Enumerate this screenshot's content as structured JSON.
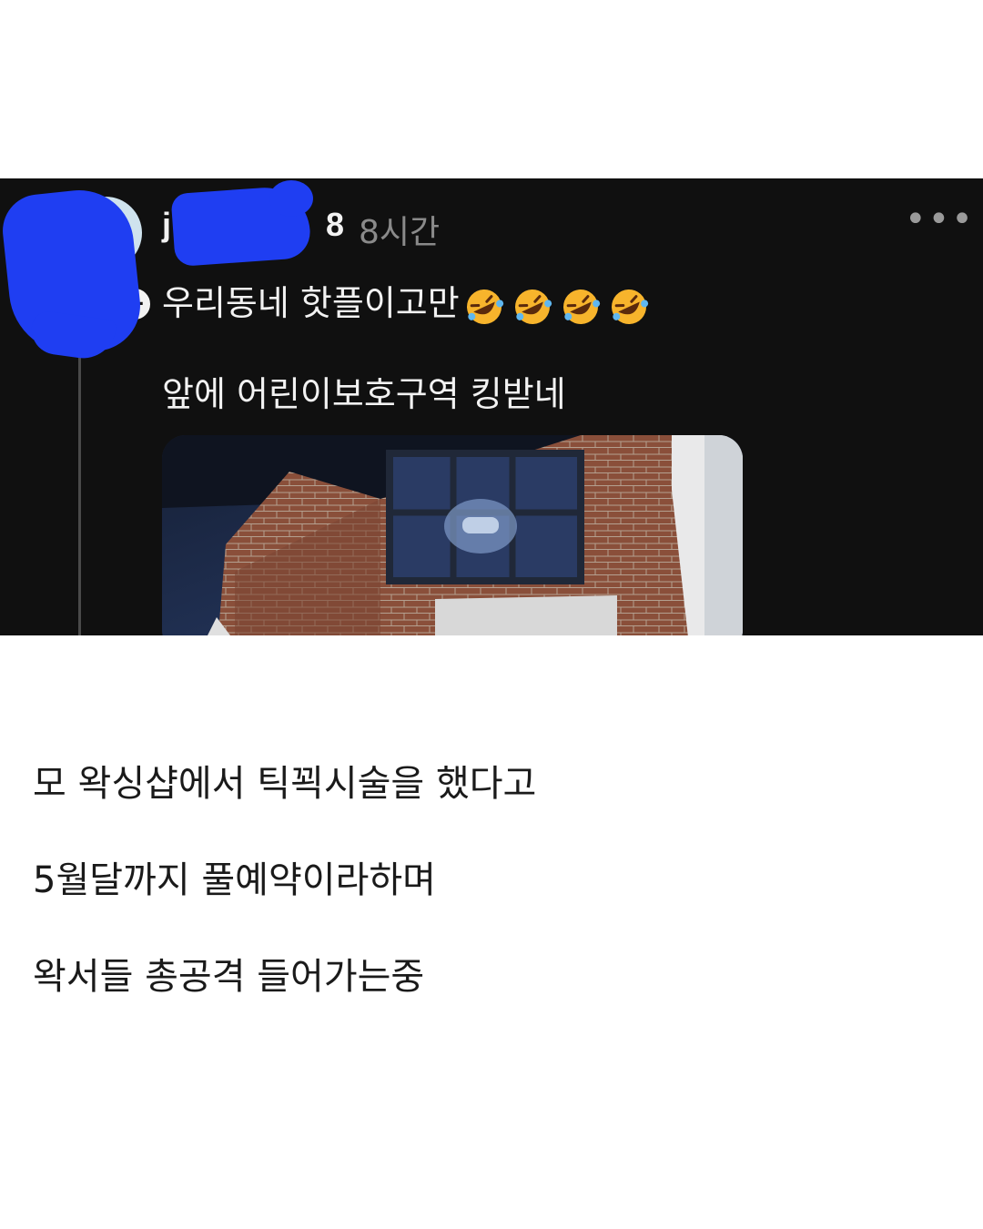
{
  "post": {
    "username_visible_start": "j",
    "username_visible_end": "8",
    "time": "8시간",
    "more_label": "•••",
    "lines": [
      "우리동네 핫플이고만",
      "앞에 어린이보호구역 킹받네"
    ],
    "emojis": [
      "rolling-on-floor-laughing",
      "rolling-on-floor-laughing",
      "rolling-on-floor-laughing",
      "rolling-on-floor-laughing"
    ]
  },
  "caption": {
    "lines": [
      "모 왁싱샵에서 틱꾁시술을 했다고",
      "5월달까지 풀예약이라하며",
      "왁서들 총공격 들어가는중"
    ]
  }
}
